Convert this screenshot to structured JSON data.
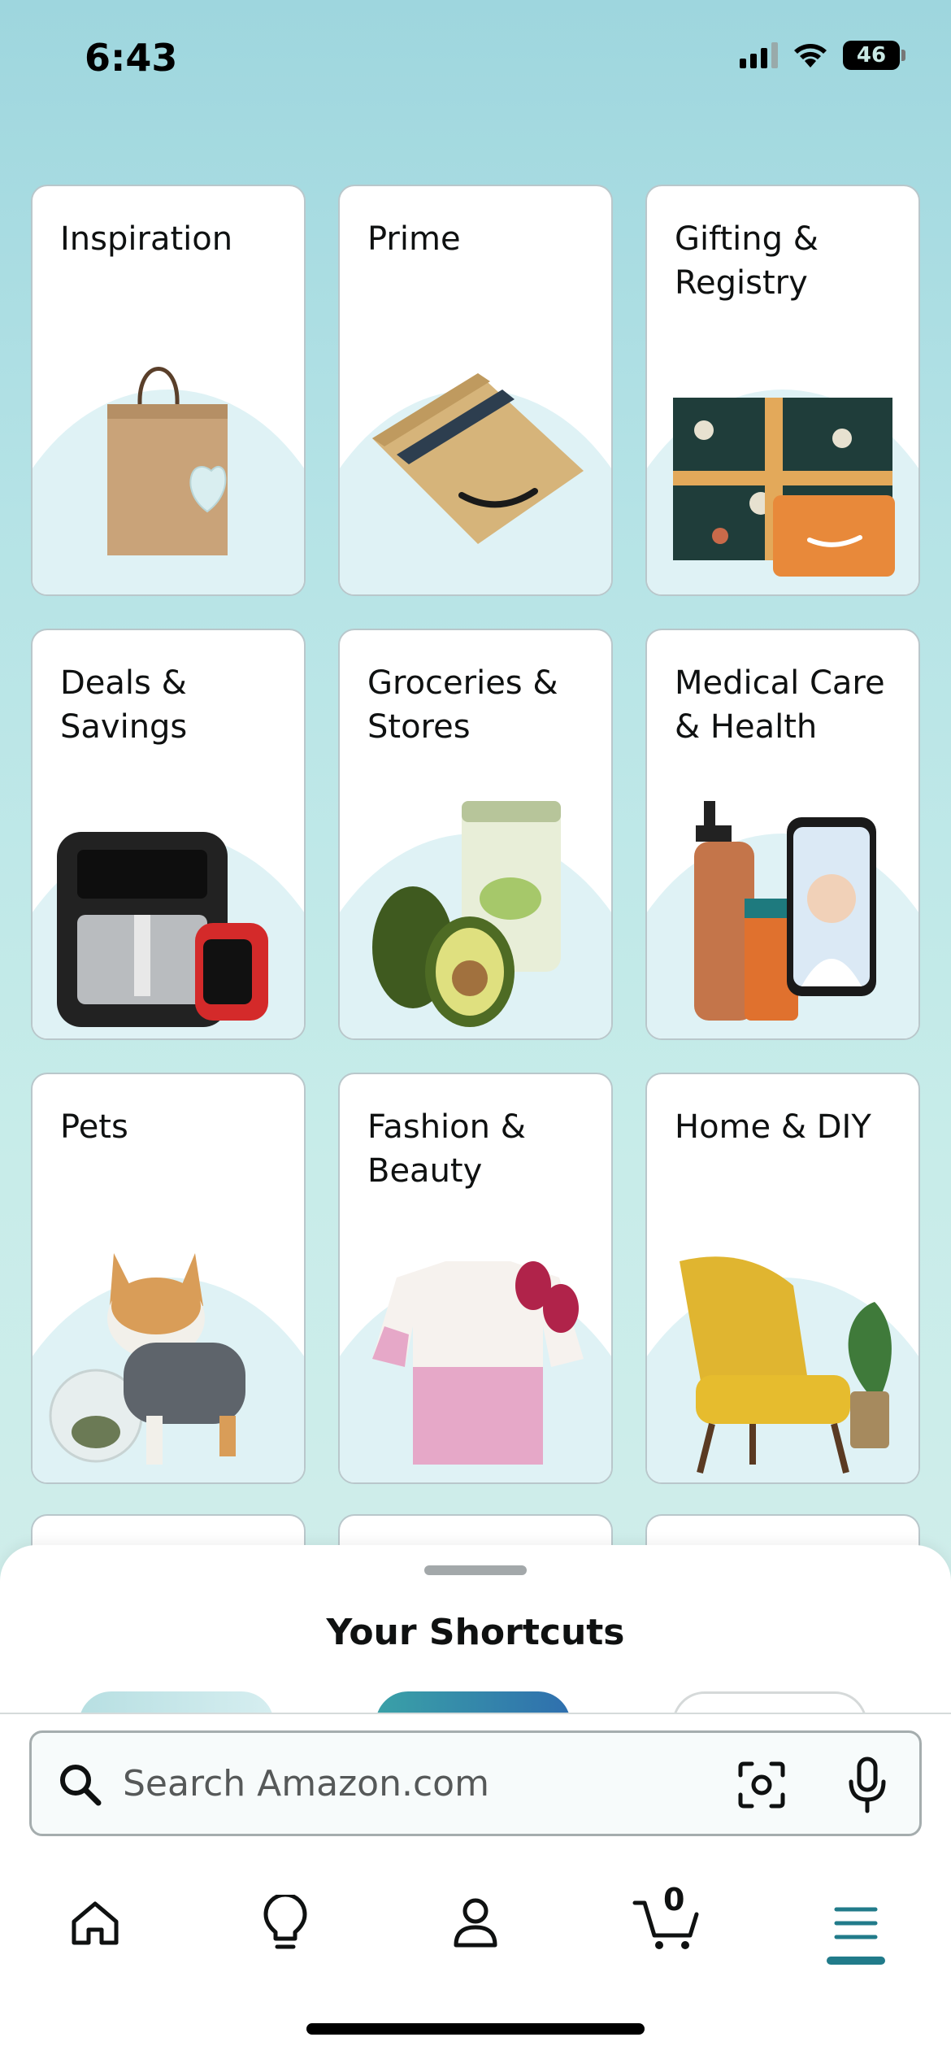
{
  "status_bar": {
    "time": "6:43",
    "battery": "46"
  },
  "categories": [
    {
      "title": "Inspiration",
      "icon": "shopping-bag-icon"
    },
    {
      "title": "Prime",
      "icon": "prime-box-icon"
    },
    {
      "title": "Gifting &\nRegistry",
      "icon": "gift-box-icon"
    },
    {
      "title": "Deals &\nSavings",
      "icon": "air-fryer-icon"
    },
    {
      "title": "Groceries &\nStores",
      "icon": "avocado-can-icon"
    },
    {
      "title": "Medical Care\n& Health",
      "icon": "pharmacy-icon"
    },
    {
      "title": "Pets",
      "icon": "corgi-icon"
    },
    {
      "title": "Fashion &\nBeauty",
      "icon": "shirt-icon"
    },
    {
      "title": "Home & DIY",
      "icon": "armchair-icon"
    }
  ],
  "shortcuts": {
    "title": "Your Shortcuts"
  },
  "search": {
    "placeholder": "Search Amazon.com"
  },
  "nav": {
    "cart_count": "0"
  },
  "colors": {
    "accent": "#217b8a",
    "text": "#0f1111",
    "card_arc": "#dff2f5"
  }
}
